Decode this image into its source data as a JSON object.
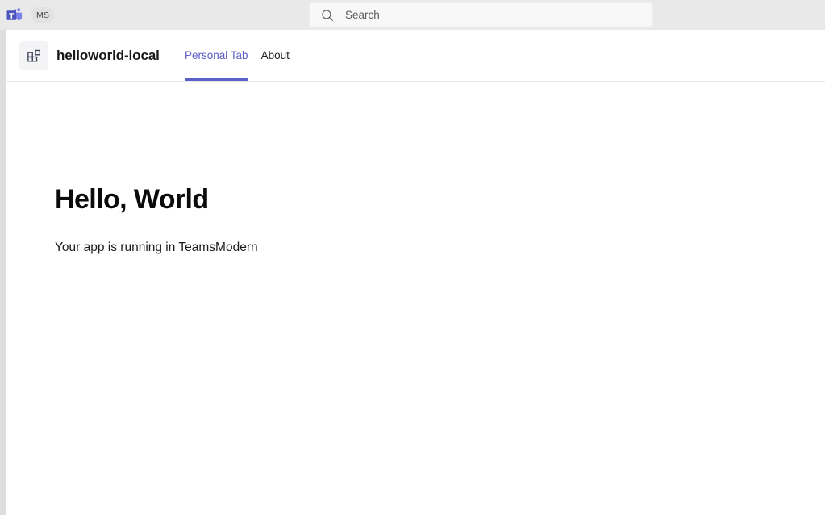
{
  "topbar": {
    "logo_icon": "microsoft-teams-logo-icon",
    "account_badge": "MS",
    "search": {
      "icon": "search-icon",
      "value": "",
      "placeholder": "Search"
    }
  },
  "app": {
    "icon": "apps-grid-icon",
    "name": "helloworld-local",
    "tabs": [
      {
        "label": "Personal Tab",
        "active": true
      },
      {
        "label": "About",
        "active": false
      }
    ]
  },
  "main": {
    "heading": "Hello, World",
    "subtitle": "Your app is running in TeamsModern"
  },
  "colors": {
    "accent_purple": "#5B5FC7",
    "teams_logo_dark": "#4B53BC",
    "teams_logo_light": "#7B83EB",
    "topbar_bg": "#E9E9E9",
    "left_rail": "#DEDEDE",
    "app_icon_fg": "#3A3F55",
    "divider": "#E6E6E6"
  }
}
